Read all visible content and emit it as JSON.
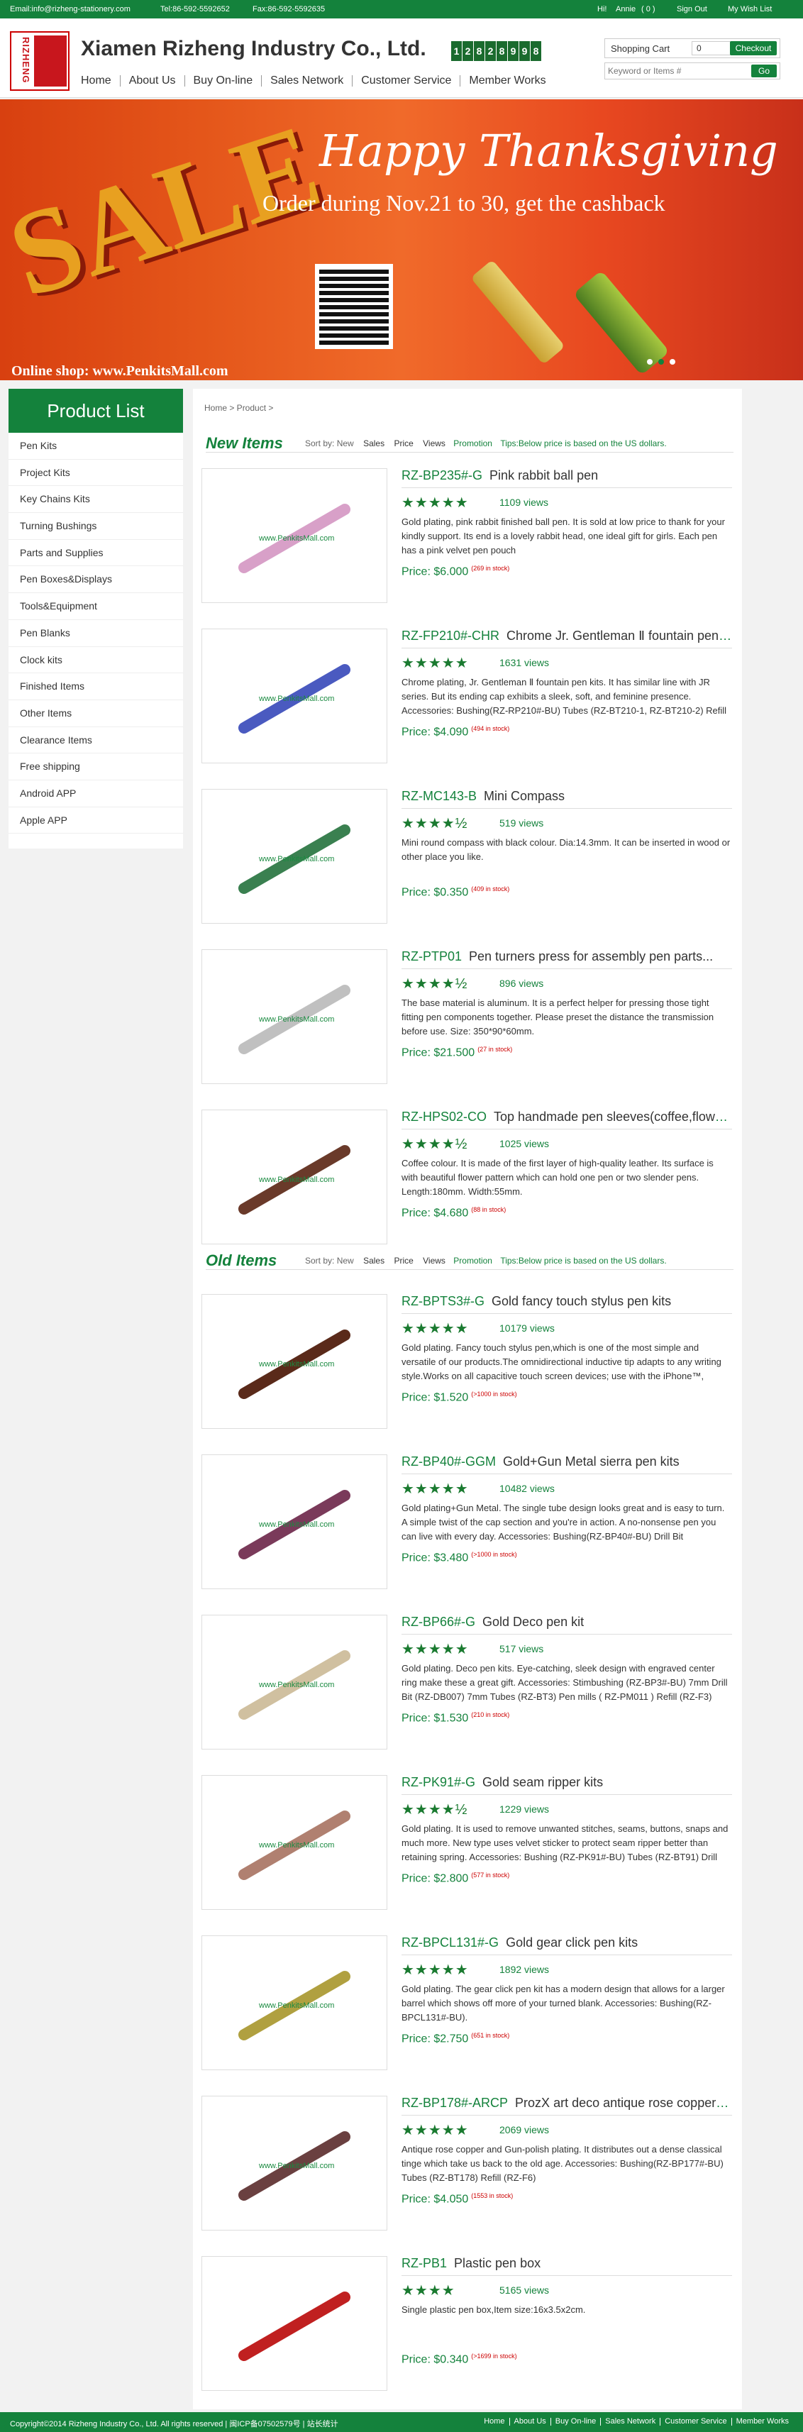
{
  "topbar": {
    "email": "Email:info@rizheng-stationery.com",
    "tel": "Tel:86-592-5592652",
    "fax": "Fax:86-592-5592635",
    "greeting": "Hi!",
    "username": "Annie",
    "message_count": "( 0 )",
    "sign_out": "Sign Out",
    "wish_list": "My Wish List"
  },
  "header": {
    "logo_text": "RIZHENG",
    "company": "Xiamen Rizheng Industry Co., Ltd.",
    "counter": [
      "1",
      "2",
      "8",
      "2",
      "8",
      "9",
      "9",
      "8"
    ],
    "nav": [
      "Home",
      "About Us",
      "Buy On-line",
      "Sales Network",
      "Customer Service",
      "Member Works"
    ],
    "cart_label": "Shopping Cart",
    "cart_qty": "0",
    "checkout": "Checkout",
    "search_placeholder": "Keyword or Items #",
    "go": "Go"
  },
  "banner": {
    "sale": "SALE",
    "title": "Happy Thanksgiving",
    "subtitle": "Order during Nov.21 to 30, get the cashback",
    "shop": "Online shop: www.PenkitsMall.com"
  },
  "sidebar": {
    "title": "Product List",
    "items": [
      "Pen Kits",
      "Project Kits",
      "Key Chains Kits",
      "Turning Bushings",
      "Parts and Supplies",
      "Pen Boxes&Displays",
      "Tools&Equipment",
      "Pen Blanks",
      "Clock kits",
      "Finished Items",
      "Other Items",
      "Clearance Items",
      "Free shipping",
      "Android APP",
      "Apple APP"
    ]
  },
  "breadcrumb": "Home > Product >",
  "sort": {
    "label": "Sort by:",
    "new": "New",
    "sales": "Sales",
    "price": "Price",
    "views": "Views",
    "promotion": "Promotion",
    "tips": "Tips:Below price is based on the US dollars."
  },
  "new_items": {
    "heading": "New Items",
    "items": [
      {
        "code": "RZ-BP235#-G",
        "name": "Pink rabbit ball pen",
        "stars": "★★★★★",
        "views": "1109 views",
        "desc": "Gold plating, pink rabbit finished ball pen. It is sold at low price to thank for your kindly support. Its end is a lovely rabbit head, one ideal gift for girls. Each pen has a pink velvet pen pouch",
        "price": "Price: $6.000",
        "stock": "(269 in stock)",
        "watermark": "www.PenkitsMall.com"
      },
      {
        "code": "RZ-FP210#-CHR",
        "name": "Chrome Jr. Gentleman Ⅱ fountain pen kits",
        "stars": "★★★★★",
        "views": "1631 views",
        "desc": "Chrome plating, Jr. Gentleman Ⅱ fountain pen kits. It has similar line with JR series. But its ending cap exhibits a sleek, soft, and feminine presence. Accessories: Bushing(RZ-RP210#-BU) Tubes (RZ-BT210-1, RZ-BT210-2) Refill",
        "price": "Price: $4.090",
        "stock": "(494 in stock)",
        "watermark": "www.PenkitsMall.com"
      },
      {
        "code": "RZ-MC143-B",
        "name": "Mini Compass",
        "stars": "★★★★½",
        "views": "519 views",
        "desc": "Mini round compass with black colour. Dia:14.3mm. It can be inserted in wood or other place you like.",
        "price": "Price: $0.350",
        "stock": "(409 in stock)",
        "watermark": "www.PenkitsMall.com"
      },
      {
        "code": "RZ-PTP01",
        "name": "Pen turners press for assembly pen parts...",
        "stars": "★★★★½",
        "views": "896 views",
        "desc": "The base material is aluminum. It is a perfect helper for pressing those tight fitting pen components together. Please preset the distance the transmission before use. Size: 350*90*60mm.",
        "price": "Price: $21.500",
        "stock": "(27 in stock)",
        "watermark": "www.PenkitsMall.com"
      },
      {
        "code": "RZ-HPS02-CO",
        "name": "Top handmade pen sleeves(coffee,flower pattern)",
        "stars": "★★★★½",
        "views": "1025 views",
        "desc": "Coffee colour. It is made of the first layer of high-quality leather. Its surface is with beautiful flower pattern which can hold one pen or two slender pens. Length:180mm. Width:55mm.",
        "price": "Price: $4.680",
        "stock": "(88 in stock)",
        "watermark": "www.PenkitsMall.com"
      }
    ]
  },
  "old_items": {
    "heading": "Old Items",
    "items": [
      {
        "code": "RZ-BPTS3#-G",
        "name": "Gold fancy touch stylus pen kits",
        "stars": "★★★★★",
        "views": "10179 views",
        "desc": "Gold plating. Fancy touch stylus pen,which is one of the most simple and versatile of our products.The omnidirectional inductive tip adapts to any writing style.Works on all capacitive touch screen devices; use with the iPhone™,",
        "price": "Price: $1.520",
        "stock": "(>1000 in stock)",
        "watermark": "www.PenkitsMall.com"
      },
      {
        "code": "RZ-BP40#-GGM",
        "name": "Gold+Gun Metal sierra pen kits",
        "stars": "★★★★★",
        "views": "10482 views",
        "desc": "Gold plating+Gun Metal. The single tube design looks great and is easy to turn. A simple twist of the cap section and you're in action. A no-nonsense pen you can live with every day. Accessories: Bushing(RZ-BP40#-BU) Drill Bit",
        "price": "Price: $3.480",
        "stock": "(>1000 in stock)",
        "watermark": "www.PenkitsMall.com"
      },
      {
        "code": "RZ-BP66#-G",
        "name": "Gold Deco pen kit",
        "stars": "★★★★★",
        "views": "517 views",
        "desc": "Gold plating. Deco pen kits. Eye-catching, sleek design with engraved center ring make these a great gift. Accessories: Stimbushing (RZ-BP3#-BU) 7mm Drill Bit (RZ-DB007) 7mm Tubes (RZ-BT3) Pen mills ( RZ-PM011 ) Refill (RZ-F3)",
        "price": "Price: $1.530",
        "stock": "(210 in stock)",
        "watermark": "www.PenkitsMall.com"
      },
      {
        "code": "RZ-PK91#-G",
        "name": "Gold seam ripper kits",
        "stars": "★★★★½",
        "views": "1229 views",
        "desc": "Gold plating. It is used to remove unwanted stitches, seams, buttons, snaps and much more. New type uses velvet sticker to protect seam ripper better than retaining spring. Accessories: Bushing (RZ-PK91#-BU) Tubes (RZ-BT91) Drill",
        "price": "Price: $2.800",
        "stock": "(577 in stock)",
        "watermark": "www.PenkitsMall.com"
      },
      {
        "code": "RZ-BPCL131#-G",
        "name": "Gold gear click pen kits",
        "stars": "★★★★★",
        "views": "1892 views",
        "desc": "Gold plating. The gear click pen kit has a modern design that allows for a larger barrel which shows off more of your turned blank. Accessories: Bushing(RZ-BPCL131#-BU).",
        "price": "Price: $2.750",
        "stock": "(651 in stock)",
        "watermark": "www.PenkitsMall.com"
      },
      {
        "code": "RZ-BP178#-ARCP",
        "name": "ProzX art deco antique rose copper pen kits",
        "stars": "★★★★★",
        "views": "2069 views",
        "desc": "Antique rose copper and Gun-polish plating. It distributes out a dense classical tinge which take us back to the old age. Accessories: Bushing(RZ-BP177#-BU) Tubes (RZ-BT178) Refill (RZ-F6)",
        "price": "Price: $4.050",
        "stock": "(1553 in stock)",
        "watermark": "www.PenkitsMall.com"
      },
      {
        "code": "RZ-PB1",
        "name": "Plastic pen box",
        "stars": "★★★★",
        "views": "5165 views",
        "desc": "Single plastic pen box,Item size:16x3.5x2cm.",
        "price": "Price: $0.340",
        "stock": "(>1699 in stock)",
        "watermark": ""
      }
    ]
  },
  "footer": {
    "copyright": "Copyright©2014 Rizheng Industry Co., Ltd. All rights reserved | 闽ICP备07502579号 | 站长统计",
    "links": [
      "Home",
      "About Us",
      "Buy On-line",
      "Sales Network",
      "Customer Service",
      "Member Works"
    ]
  },
  "colors": {
    "brand_green": "#14823c",
    "price_red": "#cc0000",
    "banner_orange": "#e4561a"
  }
}
